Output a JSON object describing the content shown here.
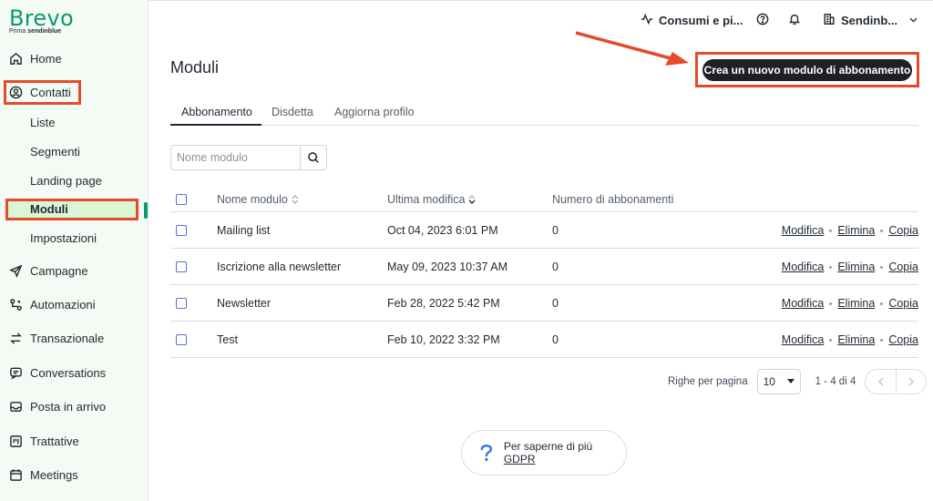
{
  "brand": {
    "name": "Brevo",
    "sub_prefix": "Prima",
    "sub_name": "sendinblue",
    "accent": "#0b996e"
  },
  "sidebar": {
    "items": [
      {
        "label": "Home",
        "icon": "home-icon"
      },
      {
        "label": "Contatti",
        "icon": "user-circle-icon"
      },
      {
        "label": "Campagne",
        "icon": "send-icon"
      },
      {
        "label": "Automazioni",
        "icon": "automation-icon"
      },
      {
        "label": "Transazionale",
        "icon": "arrows-swap-icon"
      },
      {
        "label": "Conversations",
        "icon": "chat-icon"
      },
      {
        "label": "Posta in arrivo",
        "icon": "inbox-icon"
      },
      {
        "label": "Trattative",
        "icon": "board-icon"
      },
      {
        "label": "Meetings",
        "icon": "calendar-icon"
      }
    ],
    "contatti_sub": [
      "Liste",
      "Segmenti",
      "Landing page",
      "Moduli",
      "Impostazioni"
    ],
    "active_sub": "Moduli"
  },
  "topbar": {
    "usage": "Consumi e pi...",
    "account": "Sendinb..."
  },
  "page": {
    "title": "Moduli",
    "cta": "Crea un nuovo modulo di abbonamento",
    "tabs": [
      "Abbonamento",
      "Disdetta",
      "Aggiorna profilo"
    ],
    "search_placeholder": "Nome modulo"
  },
  "table": {
    "headers": {
      "name": "Nome modulo",
      "modified": "Ultima modifica",
      "subs": "Numero di abbonamenti"
    },
    "actions": {
      "edit": "Modifica",
      "delete": "Elimina",
      "copy": "Copia"
    },
    "rows": [
      {
        "name": "Mailing list",
        "modified": "Oct 04, 2023 6:01 PM",
        "subs": "0"
      },
      {
        "name": "Iscrizione alla newsletter",
        "modified": "May 09, 2023 10:37 AM",
        "subs": "0"
      },
      {
        "name": "Newsletter",
        "modified": "Feb 28, 2022 5:42 PM",
        "subs": "0"
      },
      {
        "name": "Test",
        "modified": "Feb 10, 2022 3:32 PM",
        "subs": "0"
      }
    ]
  },
  "pager": {
    "label": "Righe per pagina",
    "per_page": "10",
    "range": "1 - 4 di 4"
  },
  "gdpr": {
    "text": "Per saperne di più",
    "link": "GDPR"
  },
  "colors": {
    "highlight": "#e44b2b",
    "button": "#1f2024"
  }
}
